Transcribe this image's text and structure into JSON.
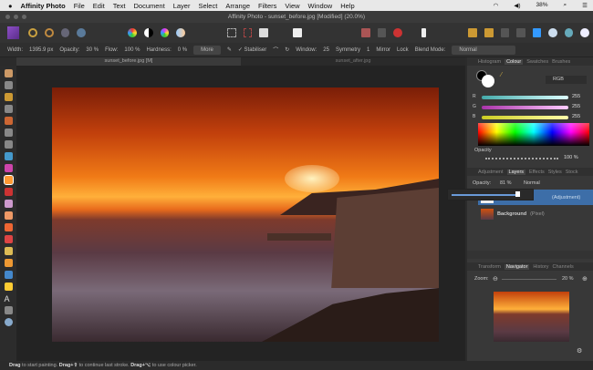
{
  "menubar": {
    "app": "Affinity Photo",
    "items": [
      "File",
      "Edit",
      "Text",
      "Document",
      "Layer",
      "Select",
      "Arrange",
      "Filters",
      "View",
      "Window",
      "Help"
    ],
    "battery": "38%"
  },
  "window": {
    "title": "Affinity Photo - sunset_before.jpg [Modified] (20.0%)"
  },
  "context": {
    "width_label": "Width:",
    "width": "1395.9 px",
    "opacity_label": "Opacity:",
    "opacity": "30 %",
    "flow_label": "Flow:",
    "flow": "100 %",
    "hardness_label": "Hardness:",
    "hardness": "0 %",
    "more": "More",
    "stabiliser": "Stabiliser",
    "window_label": "Window:",
    "window": "25",
    "symmetry": "Symmetry",
    "symmetry_val": "1",
    "mirror": "Mirror",
    "lock": "Lock",
    "blend_label": "Blend Mode:",
    "blend": "Normal"
  },
  "doc_tabs": [
    "sunset_before.jpg [M]",
    "sunset_after.jpg"
  ],
  "colour_panel": {
    "tabs": [
      "Histogram",
      "Colour",
      "Swatches",
      "Brushes"
    ],
    "model": "RGB",
    "r": "255",
    "g": "255",
    "b": "255",
    "r_label": "R",
    "g_label": "G",
    "b_label": "B",
    "opacity_label": "Opacity",
    "opacity": "100 %"
  },
  "layers_panel": {
    "tabs": [
      "Adjustment",
      "Layers",
      "Effects",
      "Styles",
      "Stock"
    ],
    "opacity_label": "Opacity:",
    "opacity": "81 %",
    "blend": "Normal",
    "layers": [
      {
        "name": "(Adjustment)"
      },
      {
        "name": "Background",
        "type": "(Pixel)"
      }
    ]
  },
  "navigator": {
    "tabs": [
      "Transform",
      "Navigator",
      "History",
      "Channels"
    ],
    "zoom_label": "Zoom:",
    "zoom": "20 %"
  },
  "status": {
    "drag1": "Drag",
    "t1": " to start painting. ",
    "drag2": "Drag+⇧",
    "t2": " to continue last stroke. ",
    "drag3": "Drag+⌥",
    "t3": " to use colour picker."
  }
}
